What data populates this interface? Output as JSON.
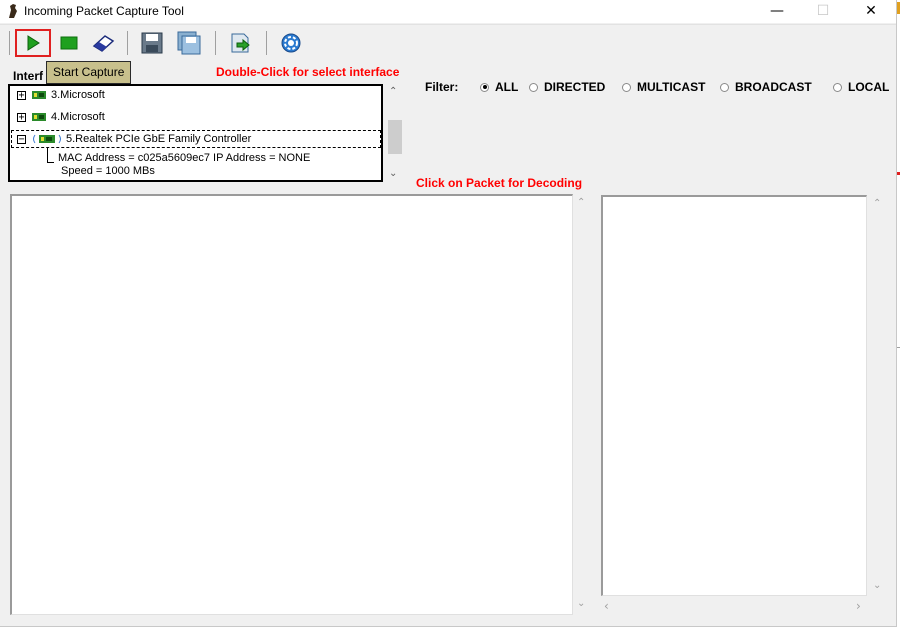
{
  "window": {
    "title": "Incoming Packet Capture Tool",
    "minimize_glyph": "—",
    "maximize_glyph": "☐",
    "close_glyph": "✕"
  },
  "toolbar": {
    "buttons": [
      {
        "name": "start-capture",
        "icon": "play-icon"
      },
      {
        "name": "stop-capture",
        "icon": "stop-icon"
      },
      {
        "name": "clear",
        "icon": "eraser-icon"
      },
      {
        "name": "save",
        "icon": "save-icon"
      },
      {
        "name": "save-all",
        "icon": "save-all-icon"
      },
      {
        "name": "export",
        "icon": "export-icon"
      },
      {
        "name": "settings",
        "icon": "gear-icon"
      }
    ],
    "tooltip": "Start Capture"
  },
  "interfaces": {
    "label": "Interf",
    "hint": "Double-Click for select interface",
    "items": [
      {
        "expander": "+",
        "label": "3.Microsoft"
      },
      {
        "expander": "+",
        "label": "4.Microsoft"
      },
      {
        "expander": "−",
        "label": "5.Realtek PCIe GbE Family Controller",
        "details": [
          "MAC Address = c025a5609ec7 IP Address = NONE",
          "Speed = 1000 MBs"
        ]
      }
    ]
  },
  "filter": {
    "label": "Filter:",
    "options": [
      "ALL",
      "DIRECTED",
      "MULTICAST",
      "BROADCAST",
      "LOCAL"
    ],
    "selected": "ALL"
  },
  "packets": {
    "hint": "Click on Packet for Decoding"
  },
  "colors": {
    "hint_red": "#ff0000",
    "tooltip_bg": "#c8c08c",
    "window_bg": "#f0f0f0",
    "play_green": "#22a022",
    "highlight_border": "#e02020"
  }
}
